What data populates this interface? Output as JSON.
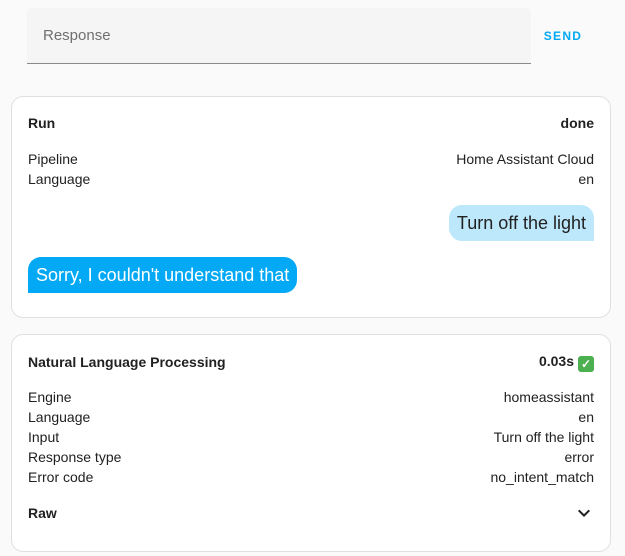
{
  "input": {
    "placeholder": "Response",
    "value": ""
  },
  "send_label": "SEND",
  "run": {
    "title": "Run",
    "status": "done",
    "rows": [
      {
        "key": "Pipeline",
        "value": "Home Assistant Cloud"
      },
      {
        "key": "Language",
        "value": "en"
      }
    ],
    "user_message": "Turn off the light",
    "assistant_message": "Sorry, I couldn't understand that"
  },
  "nlp": {
    "title": "Natural Language Processing",
    "duration": "0.03s",
    "status_icon": "check-icon",
    "rows": [
      {
        "key": "Engine",
        "value": "homeassistant"
      },
      {
        "key": "Language",
        "value": "en"
      },
      {
        "key": "Input",
        "value": "Turn off the light"
      },
      {
        "key": "Response type",
        "value": "error"
      },
      {
        "key": "Error code",
        "value": "no_intent_match"
      }
    ],
    "raw_label": "Raw",
    "raw_icon": "chevron-down-icon"
  },
  "colors": {
    "accent": "#03a9f4",
    "user_bubble": "#bde8fb",
    "success": "#4caf50"
  }
}
